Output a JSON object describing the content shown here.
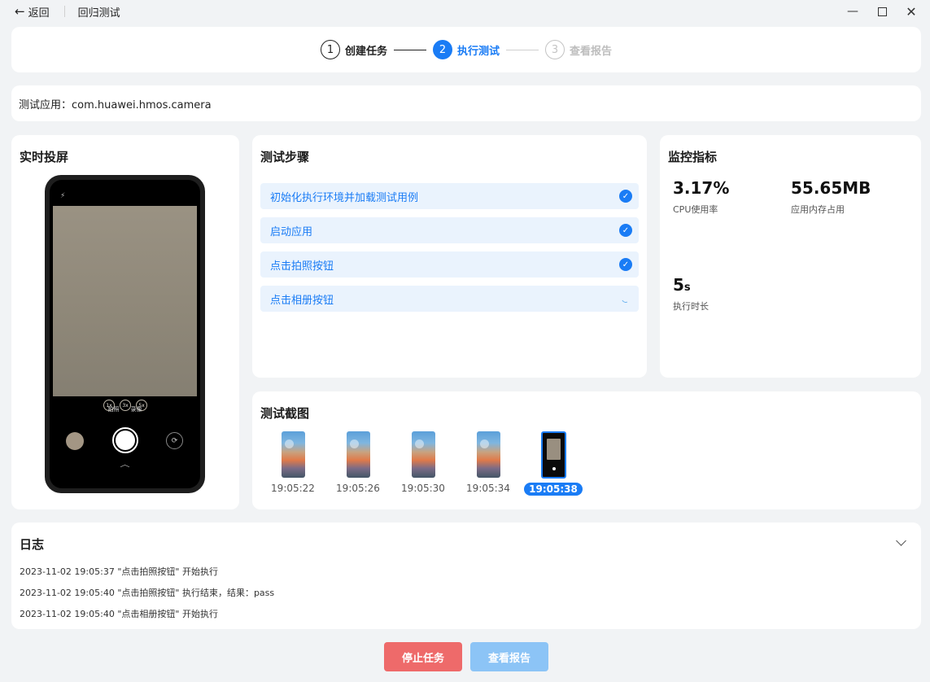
{
  "titlebar": {
    "back_label": "返回",
    "title": "回归测试"
  },
  "stepper": {
    "steps": [
      {
        "num": "1",
        "label": "创建任务",
        "state": "done"
      },
      {
        "num": "2",
        "label": "执行测试",
        "state": "active"
      },
      {
        "num": "3",
        "label": "查看报告",
        "state": "todo"
      }
    ]
  },
  "app": {
    "label": "测试应用：com.huawei.hmos.camera"
  },
  "screen": {
    "title": "实时投屏",
    "zoom_levels": [
      "1x",
      "3x",
      "5x"
    ],
    "modes": [
      "拍照",
      "录像"
    ]
  },
  "steps_panel": {
    "title": "测试步骤",
    "items": [
      {
        "label": "初始化执行环境并加载测试用例",
        "status": "done"
      },
      {
        "label": "启动应用",
        "status": "done"
      },
      {
        "label": "点击拍照按钮",
        "status": "done"
      },
      {
        "label": "点击相册按钮",
        "status": "running"
      }
    ]
  },
  "monitor": {
    "title": "监控指标",
    "cpu": {
      "value": "3.17%",
      "label": "CPU使用率"
    },
    "memory": {
      "value": "55.65MB",
      "label": "应用内存占用"
    },
    "duration": {
      "value": "5",
      "unit": "s",
      "label": "执行时长"
    }
  },
  "screenshots": {
    "title": "测试截图",
    "items": [
      {
        "time": "19:05:22",
        "selected": false
      },
      {
        "time": "19:05:26",
        "selected": false
      },
      {
        "time": "19:05:30",
        "selected": false
      },
      {
        "time": "19:05:34",
        "selected": false
      },
      {
        "time": "19:05:38",
        "selected": true
      }
    ]
  },
  "log": {
    "title": "日志",
    "lines": [
      "2023-11-02 19:05:37 \"点击拍照按钮\" 开始执行",
      "2023-11-02 19:05:40 \"点击拍照按钮\" 执行结束，结果：pass",
      "2023-11-02 19:05:40 \"点击相册按钮\" 开始执行"
    ]
  },
  "actions": {
    "stop_label": "停止任务",
    "report_label": "查看报告"
  },
  "colors": {
    "accent": "#1a7cf5",
    "stop": "#ee6a6a",
    "report_disabled": "#8cc4f6"
  }
}
